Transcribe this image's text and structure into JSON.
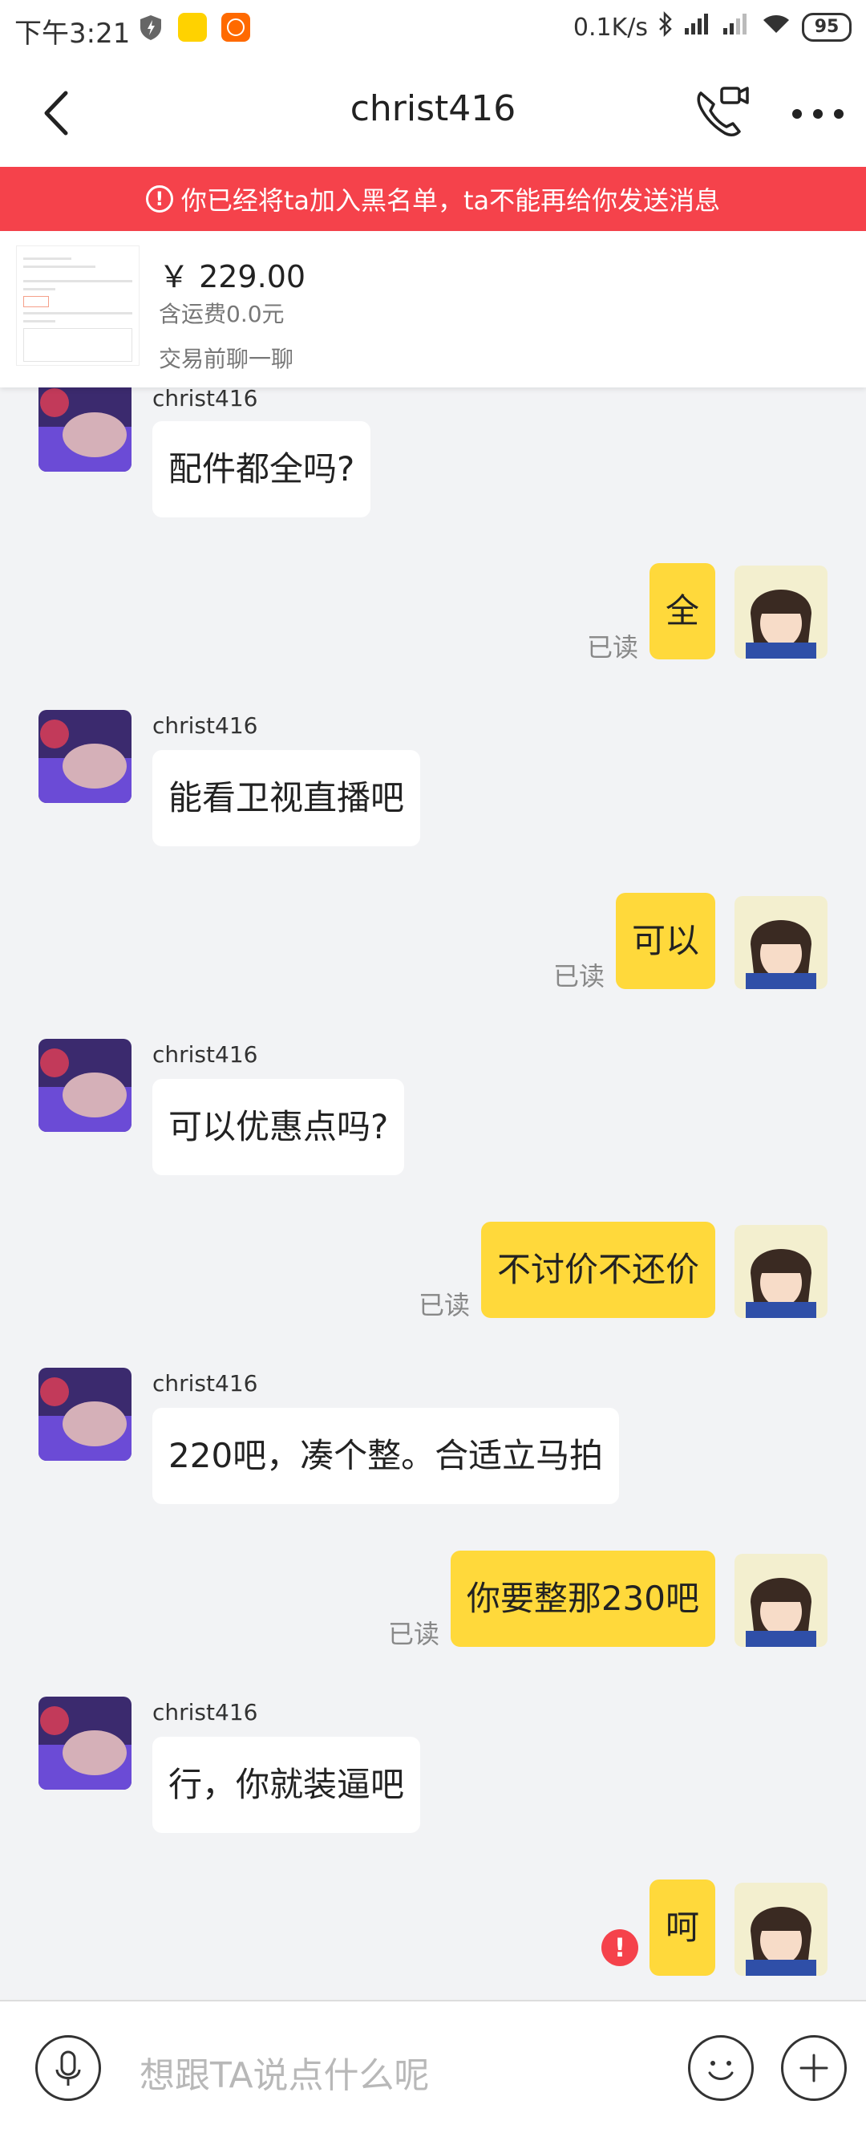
{
  "status_bar": {
    "time": "下午3:21",
    "network_speed": "0.1K/s",
    "battery": "95",
    "icons": [
      "security-icon",
      "app-icon-yellow",
      "mi-icon",
      "bluetooth-icon",
      "hd-signal-icon",
      "signal-icon",
      "wifi-icon"
    ]
  },
  "header": {
    "title": "christ416",
    "back_icon": "chevron-left-icon",
    "call_icon": "phone-video-icon",
    "more_icon": "more-dots-icon"
  },
  "banner": {
    "text": "你已经将ta加入黑名单，ta不能再给你发送消息",
    "icon": "alert-icon",
    "color": "#f5424b"
  },
  "product": {
    "price": "￥ 229.00",
    "shipping": "含运费0.0元",
    "prompt": "交易前聊一聊"
  },
  "messages": [
    {
      "from": "them",
      "name": "christ416",
      "text": "配件都全吗?"
    },
    {
      "from": "me",
      "text": "全",
      "status": "已读"
    },
    {
      "from": "them",
      "name": "christ416",
      "text": "能看卫视直播吧"
    },
    {
      "from": "me",
      "text": "可以",
      "status": "已读"
    },
    {
      "from": "them",
      "name": "christ416",
      "text": "可以优惠点吗?"
    },
    {
      "from": "me",
      "text": "不讨价不还价",
      "status": "已读"
    },
    {
      "from": "them",
      "name": "christ416",
      "text": "220吧，凑个整。合适立马拍"
    },
    {
      "from": "me",
      "text": "你要整那230吧",
      "status": "已读"
    },
    {
      "from": "them",
      "name": "christ416",
      "text": "行，你就装逼吧"
    },
    {
      "from": "me",
      "text": "呵",
      "status": "failed"
    }
  ],
  "input": {
    "placeholder": "想跟TA说点什么呢"
  },
  "colors": {
    "accent": "#ffd93b",
    "banner": "#f5424b",
    "background": "#f2f3f5"
  }
}
